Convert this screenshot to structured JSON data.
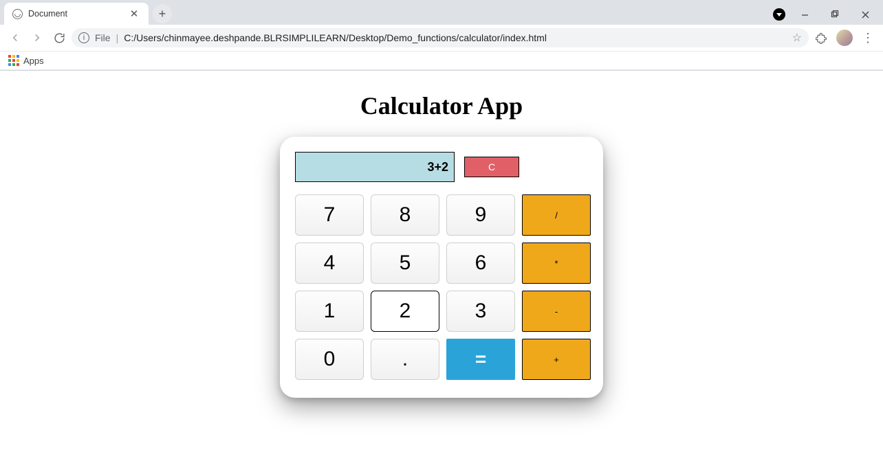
{
  "browser": {
    "tab_title": "Document",
    "url_scheme": "File",
    "url_path": "C:/Users/chinmayee.deshpande.BLRSIMPLILEARN/Desktop/Demo_functions/calculator/index.html",
    "apps_label": "Apps"
  },
  "page": {
    "title": "Calculator App"
  },
  "calculator": {
    "display_value": "3+2",
    "clear_label": "C",
    "keys": {
      "k7": "7",
      "k8": "8",
      "k9": "9",
      "div": "/",
      "k4": "4",
      "k5": "5",
      "k6": "6",
      "mul": "*",
      "k1": "1",
      "k2": "2",
      "k3": "3",
      "sub": "-",
      "k0": "0",
      "dot": ".",
      "eq": "=",
      "add": "+"
    }
  }
}
